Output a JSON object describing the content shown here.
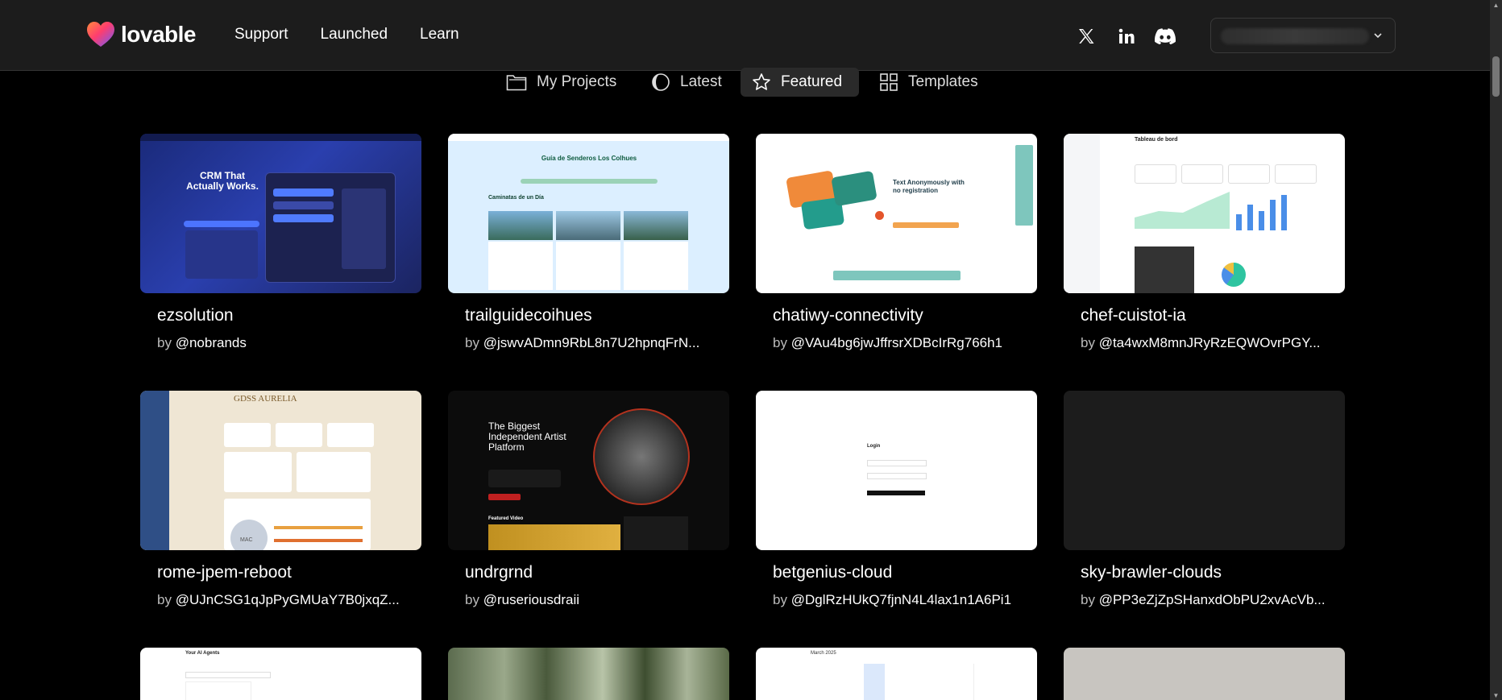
{
  "brand": {
    "name": "lovable"
  },
  "nav": {
    "support": "Support",
    "launched": "Launched",
    "learn": "Learn"
  },
  "tabs": {
    "my_projects": "My Projects",
    "latest": "Latest",
    "featured": "Featured",
    "templates": "Templates",
    "active": "Featured"
  },
  "by_label": "by",
  "projects": [
    {
      "name": "ezsolution",
      "author": "@nobrands"
    },
    {
      "name": "trailguidecoihues",
      "author": "@jswvADmn9RbL8n7U2hpnqFrN..."
    },
    {
      "name": "chatiwy-connectivity",
      "author": "@VAu4bg6jwJffrsrXDBcIrRg766h1"
    },
    {
      "name": "chef-cuistot-ia",
      "author": "@ta4wxM8mnJRyRzEQWOvrPGY..."
    },
    {
      "name": "rome-jpem-reboot",
      "author": "@UJnCSG1qJpPyGMUaY7B0jxqZ..."
    },
    {
      "name": "undrgrnd",
      "author": "@ruseriousdraii"
    },
    {
      "name": "betgenius-cloud",
      "author": "@DglRzHUkQ7fjnN4L4lax1n1A6Pi1"
    },
    {
      "name": "sky-brawler-clouds",
      "author": "@PP3eZjZpSHanxdObPU2xvAcVb..."
    }
  ],
  "thumb_text": {
    "crm_headline": "CRM That Actually Works.",
    "trail_title": "Guía de Senderos Los Colhues",
    "trail_section": "Caminatas de un Día",
    "chat_headline": "Text Anonymously with no registration",
    "chef_title": "Tableau de bord",
    "aurelia_title": "GDSS AURELIA",
    "aurelia_mac": "MAC",
    "undr_headline": "The Biggest Independent Artist Platform",
    "undr_featured": "Featured Video",
    "login_title": "Login",
    "agents_title": "Your AI Agents",
    "calendar_month": "March 2025"
  },
  "colors": {
    "header_bg": "#1c1c1c",
    "page_bg": "#000000",
    "tab_active_bg": "#2a2a2a"
  }
}
